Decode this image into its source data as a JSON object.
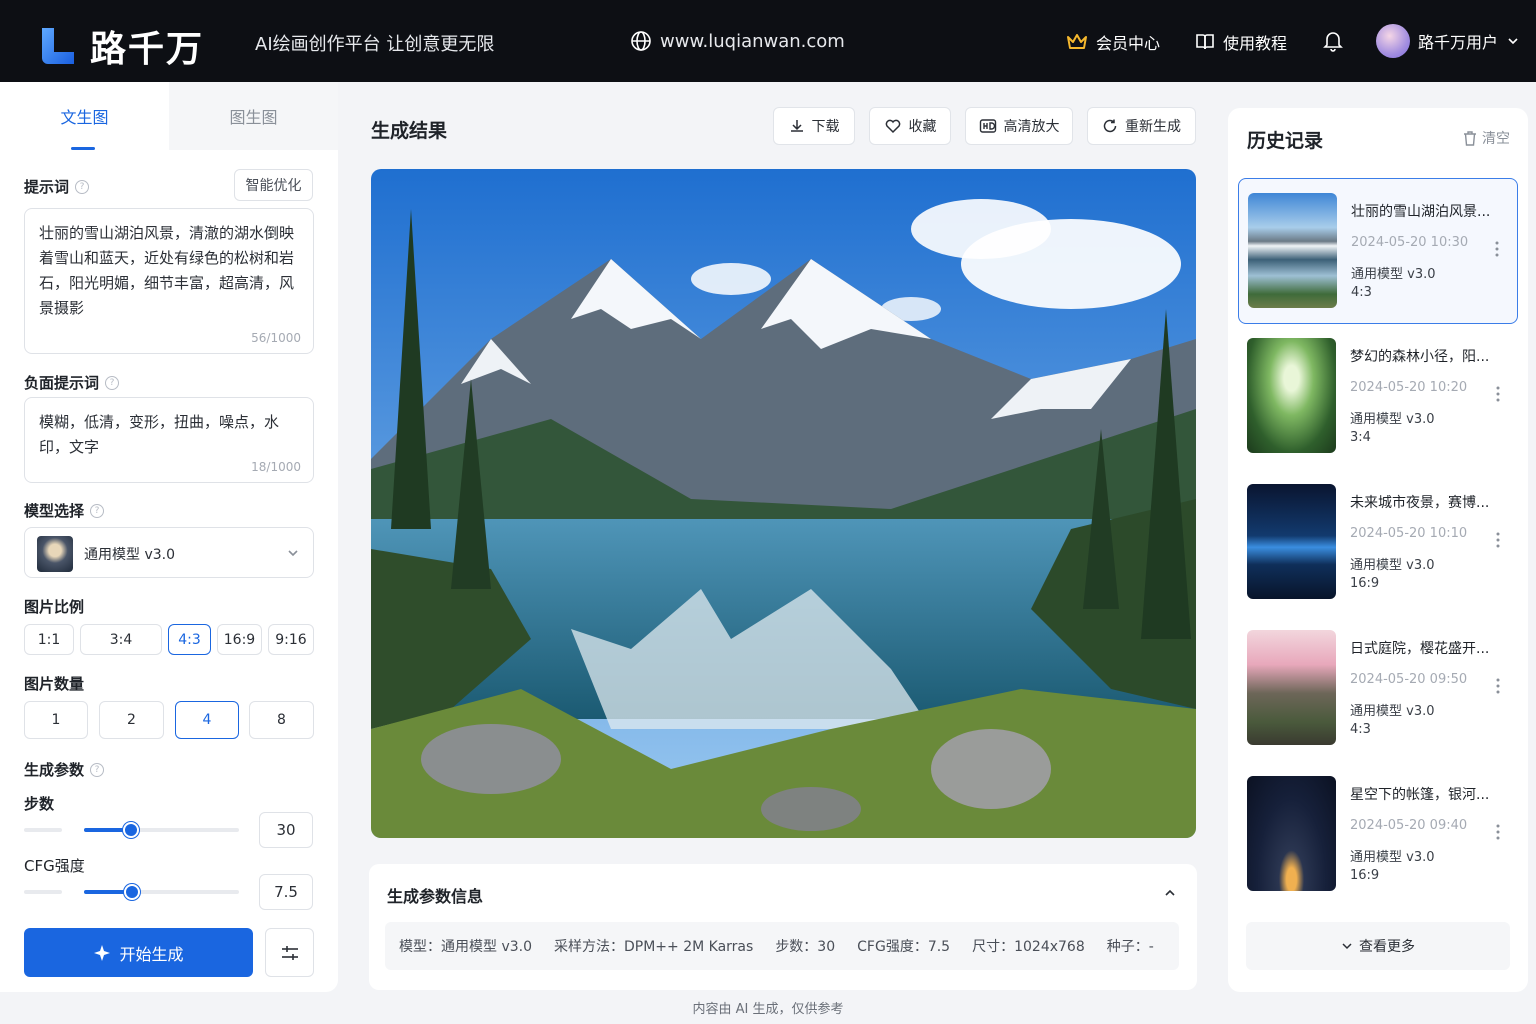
{
  "header": {
    "brand": "路千万",
    "slogan": "AI绘画创作平台  让创意更无限",
    "site_url": "www.luqianwan.com",
    "vip_label": "会员中心",
    "tutorial_label": "使用教程",
    "username": "路千万用户"
  },
  "left_panel": {
    "tabs": [
      "文生图",
      "图生图"
    ],
    "prompt_label": "提示词",
    "optimize_label": "智能优化",
    "prompt_text": "壮丽的雪山湖泊风景，清澈的湖水倒映着雪山和蓝天，近处有绿色的松树和岩石，阳光明媚，细节丰富，超高清，风景摄影",
    "prompt_count": "56/1000",
    "negative_label": "负面提示词",
    "negative_text": "模糊，低清，变形，扭曲，噪点，水印，文字",
    "negative_count": "18/1000",
    "model_label": "模型选择",
    "model_value": "通用模型 v3.0",
    "ratio_label": "图片比例",
    "ratios": [
      "1:1",
      "3:4",
      "4:3",
      "16:9",
      "9:16"
    ],
    "ratio_selected": "4:3",
    "quantity_label": "图片数量",
    "quantities": [
      "1",
      "2",
      "4",
      "8"
    ],
    "quantity_selected": "4",
    "params_label": "生成参数",
    "steps_label": "步数",
    "steps_value": "30",
    "steps_fraction": 0.3,
    "cfg_label": "CFG强度",
    "cfg_value": "7.5",
    "cfg_fraction": 0.31,
    "generate_label": "开始生成"
  },
  "main": {
    "title": "生成结果",
    "tools": [
      "下载",
      "收藏",
      "高清放大",
      "重新生成"
    ],
    "info_title": "生成参数信息",
    "info": {
      "model": "模型：通用模型 v3.0",
      "sampler": "采样方法：DPM++ 2M Karras",
      "steps": "步数：30",
      "cfg": "CFG强度：7.5",
      "size": "尺寸：1024x768",
      "seed": "种子：-"
    }
  },
  "history": {
    "title": "历史记录",
    "clear_label": "清空",
    "items": [
      {
        "title": "壮丽的雪山湖泊风景...",
        "date": "2024-05-20 10:30",
        "model": "通用模型 v3.0",
        "ratio": "4:3"
      },
      {
        "title": "梦幻的森林小径，阳...",
        "date": "2024-05-20 10:20",
        "model": "通用模型 v3.0",
        "ratio": "3:4"
      },
      {
        "title": "未来城市夜景，赛博...",
        "date": "2024-05-20 10:10",
        "model": "通用模型 v3.0",
        "ratio": "16:9"
      },
      {
        "title": "日式庭院，樱花盛开...",
        "date": "2024-05-20 09:50",
        "model": "通用模型 v3.0",
        "ratio": "4:3"
      },
      {
        "title": "星空下的帐篷，银河...",
        "date": "2024-05-20 09:40",
        "model": "通用模型 v3.0",
        "ratio": "16:9"
      }
    ],
    "more_label": "查看更多"
  },
  "footer": "内容由 AI 生成，仅供参考"
}
